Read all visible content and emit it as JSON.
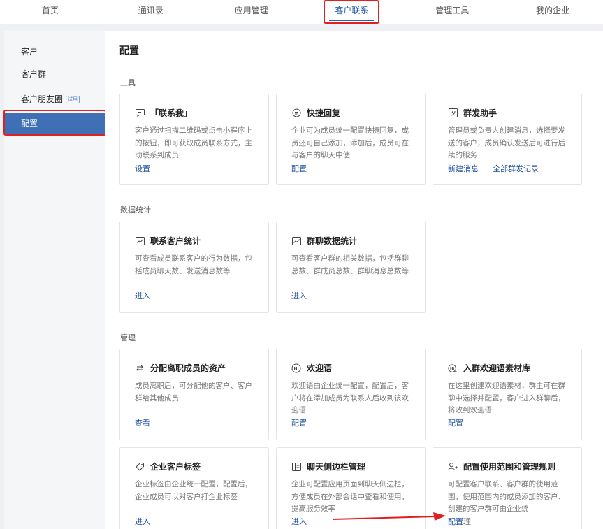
{
  "topnav": {
    "tabs": [
      "首页",
      "通讯录",
      "应用管理",
      "客户联系",
      "管理工具",
      "我的企业"
    ],
    "active_index": 3
  },
  "sidebar": {
    "items": [
      "客户",
      "客户群",
      "客户朋友圈",
      "配置"
    ],
    "badge": "试用",
    "active_index": 3
  },
  "main": {
    "title": "配置",
    "sections": [
      "工具",
      "数据统计",
      "管理"
    ],
    "cards": {
      "contact_me": {
        "title": "「联系我」",
        "desc": "客户通过扫描二维码或点击小程序上的按钮，即可获取成员联系方式，主动联系到成员",
        "link": "设置"
      },
      "quick_reply": {
        "title": "快捷回复",
        "desc": "企业可为成员统一配置快捷回复，成员还可自己添加，添加后，成员可在与客户的聊天中使",
        "link": "配置"
      },
      "mass_send": {
        "title": "群发助手",
        "desc": "管理员或负责人创建消息，选择要发送的客户，成员确认发送后可进行后续的服务",
        "link": "新建消息",
        "link2": "全部群发记录"
      },
      "contact_stats": {
        "title": "联系客户统计",
        "desc": "可查看成员联系客户的行为数据，包括成员聊天数、发送消息数等",
        "link": "进入"
      },
      "group_stats": {
        "title": "群聊数据统计",
        "desc": "可查看客户群的相关数据，包括群聊总数、群成员总数、群聊消息总数等",
        "link": "进入"
      },
      "assign_assets": {
        "title": "分配离职成员的资产",
        "desc": "成员离职后，可分配他的客户、客户群给其他成员",
        "link": "查看"
      },
      "welcome": {
        "title": "欢迎语",
        "desc": "欢迎语由企业统一配置，配置后，客户将在添加成员为联系人后收到该欢迎语",
        "link": "配置"
      },
      "group_welcome": {
        "title": "入群欢迎语素材库",
        "desc": "在这里创建欢迎语素材，群主可在群聊中选择并配置，客户进入群聊后，将收到欢迎语",
        "link": "配置"
      },
      "tags": {
        "title": "企业客户标签",
        "desc": "企业标签由企业统一配置，配置后，企业成员可以对客户打企业标签",
        "link": "进入"
      },
      "sidebar_mgmt": {
        "title": "聊天侧边栏管理",
        "desc": "企业可配置应用页面到聊天侧边栏，方便成员在外部会话中查看和使用，提高服务效率",
        "link": "进入"
      },
      "scope_rules": {
        "title": "配置使用范围和管理规则",
        "desc": "可配置客户联系、客户群的使用范围，使用范围内的成员添加的客户、创建的客户群可由企业统",
        "link": "配置",
        "link_suffix": "理"
      }
    }
  },
  "colors": {
    "accent": "#2a5fa6",
    "sidebar_active": "#3f6fb5",
    "link": "#1c4f9c",
    "highlight": "#e02020"
  }
}
